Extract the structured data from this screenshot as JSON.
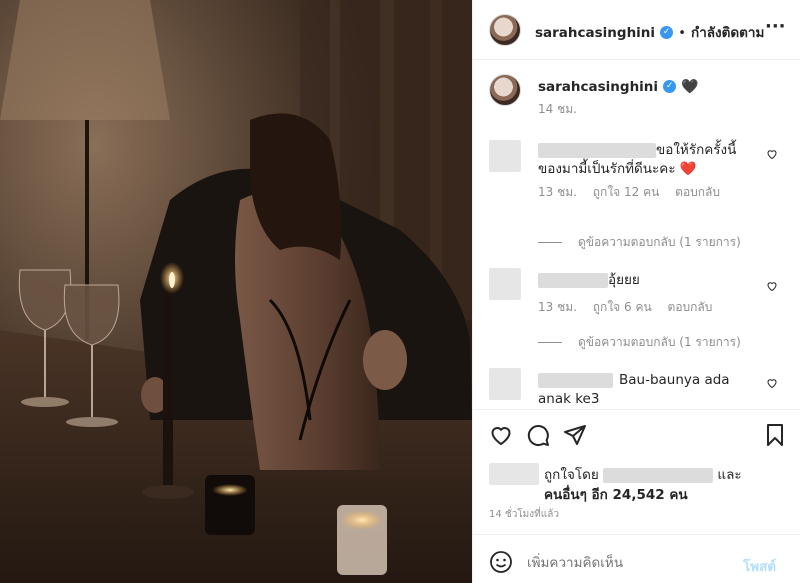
{
  "header": {
    "username": "sarahcasinghini",
    "follow_status": "กำลังติดตาม",
    "separator": "•",
    "more": "···"
  },
  "caption": {
    "username": "sarahcasinghini",
    "emoji": "🖤",
    "time": "14 ชม."
  },
  "comments": [
    {
      "text_line1": "ขอให้รักครั้งนี้",
      "text_line2": "ของมามี้เป็นรักที่ดีนะคะ",
      "emoji": "❤️",
      "time": "13 ชม.",
      "likes": "ถูกใจ 12 คน",
      "reply": "ตอบกลับ",
      "view_replies": "ดูข้อความตอบกลับ (1 รายการ)"
    },
    {
      "text_line1": "อุ้ยยย",
      "time": "13 ชม.",
      "likes": "ถูกใจ 6 คน",
      "reply": "ตอบกลับ",
      "view_replies": "ดูข้อความตอบกลับ (1 รายการ)"
    },
    {
      "text_line1": "Bau-baunya ada",
      "text_line2": "anak ke3"
    }
  ],
  "likes": {
    "liked_by": "ถูกใจโดย",
    "and": "และ",
    "others": "คนอื่นๆ อีก 24,542 คน"
  },
  "post_time": "14 ชั่วโมงที่แล้ว",
  "comment_box": {
    "placeholder": "เพิ่มความคิดเห็น",
    "post_label": "โพสต์"
  },
  "icons": {
    "like": "heart-icon",
    "comment": "comment-icon",
    "share": "share-icon",
    "save": "bookmark-icon",
    "emoji": "smiley-icon",
    "verified": "verified-badge-icon"
  },
  "colors": {
    "verified": "#3897f0",
    "post_link": "#b2dffc",
    "heart_red": "#ed4956",
    "muted": "#8e8e8e"
  }
}
